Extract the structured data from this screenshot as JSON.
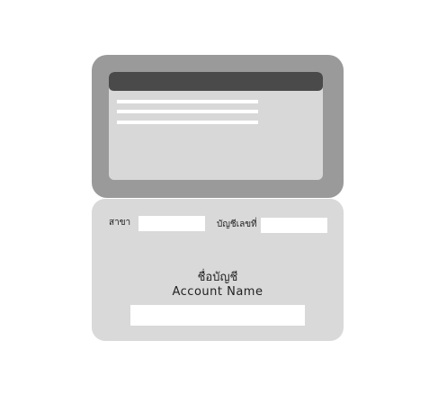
{
  "card": {
    "branch_label": "สาขา",
    "account_number_label": "บัญชีเลขที่",
    "account_name_thai": "ชื่อบัญชี",
    "account_name_english": "Account Name"
  },
  "fields": {
    "branch_value": "",
    "account_number_value": "",
    "account_name_value": ""
  },
  "colors": {
    "frame": "#9a9a9a",
    "screen": "#d8d8d8",
    "screen_header": "#4a4a4a",
    "card": "#d9d9d9"
  }
}
